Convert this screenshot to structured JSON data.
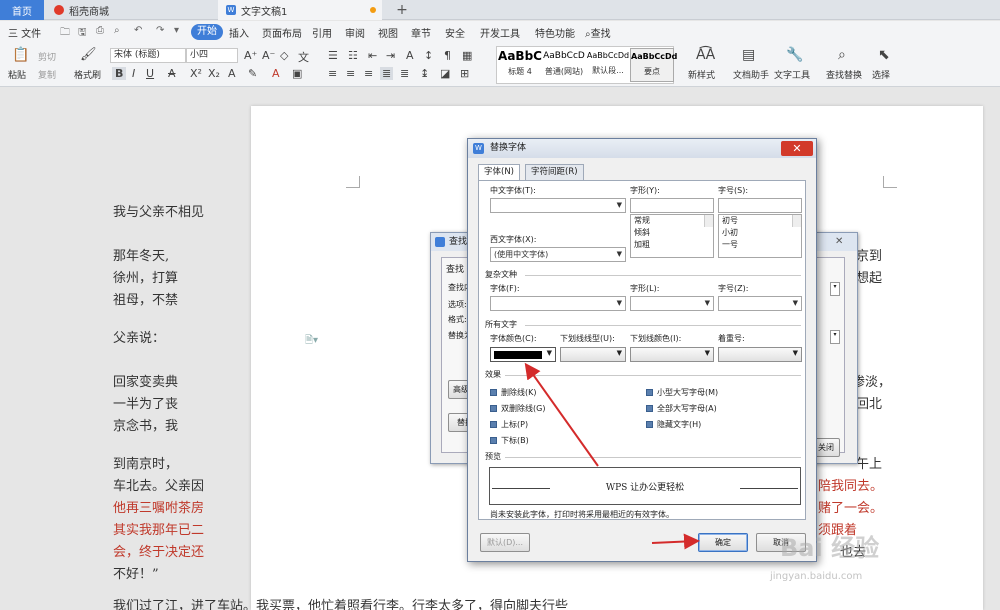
{
  "tabs": {
    "home": "首页",
    "store": "稻壳商城",
    "doc": "文字文稿1",
    "add": "+"
  },
  "menubar": {
    "file": "三 文件",
    "start": "开始",
    "items": [
      "插入",
      "页面布局",
      "引用",
      "审阅",
      "视图",
      "章节",
      "安全",
      "开发工具",
      "特色功能",
      "查找"
    ]
  },
  "toolbar": {
    "paste": "粘贴",
    "cut": "剪切",
    "copy": "复制",
    "format_painter": "格式刷",
    "font_name": "宋体 (标题)",
    "font_size": "小四",
    "styles": [
      {
        "sample": "AaBbC",
        "name": "标题 4"
      },
      {
        "sample": "AaBbCcD",
        "name": "普通(网站)"
      },
      {
        "sample": "AaBbCcDd",
        "name": "默认段..."
      },
      {
        "sample": "AaBbCcDd",
        "name": "要点"
      }
    ],
    "new_style": "新样式",
    "doc_assistant": "文档助手",
    "text_tools": "文字工具",
    "find_replace": "查找替换",
    "select": "选择"
  },
  "document": {
    "paragraphs": [
      {
        "text": "我与父亲不相见",
        "red": false
      },
      {
        "text": "那年冬天,",
        "red": false
      },
      {
        "text": "徐州，打算",
        "red": false
      },
      {
        "text": "祖母，不禁",
        "red": false
      },
      {
        "text": "父亲说：",
        "red": false
      },
      {
        "text": "回家变卖典",
        "red": false
      },
      {
        "text": "一半为了丧",
        "red": false
      },
      {
        "text": "京念书，我",
        "red": false
      },
      {
        "text": "到南京时，",
        "red": false
      },
      {
        "text": "车北去。父亲因",
        "red": true
      },
      {
        "text": "他再三嘱咐茶房",
        "red": true
      },
      {
        "text": "其实我那年已二",
        "red": true
      },
      {
        "text": "会，终于决定还",
        "red": true
      },
      {
        "text": "不好！”",
        "red": false
      },
      {
        "text": "我们过了江，进了车站。我买票，他忙着照看行李。行李太多了，得向脚夫行些",
        "red": false
      }
    ],
    "right_fragments": [
      "京到",
      "想起",
      "渗淡，",
      "回北",
      "午上",
      "陪我同去。",
      "赌了一会。",
      "须跟着",
      "也去",
      "不好"
    ]
  },
  "find_dialog": {
    "title": "查找和替换",
    "tab": "查找",
    "labels": [
      "查找内容",
      "选项:",
      "格式:",
      "替换为"
    ],
    "advanced": "高级搜",
    "replace": "替换",
    "close_btn": "关闭"
  },
  "font_dialog": {
    "title": "替换字体",
    "tabs": [
      "字体(N)",
      "字符间距(R)"
    ],
    "chinese_font_label": "中文字体(T):",
    "chinese_font_value": "",
    "western_font_label": "西文字体(X):",
    "western_font_value": "(使用中文字体)",
    "style_label": "字形(Y):",
    "style_options": [
      "常规",
      "倾斜",
      "加粗"
    ],
    "size_label": "字号(S):",
    "size_options": [
      "初号",
      "小初",
      "一号"
    ],
    "complex_section": "复杂文种",
    "complex_font_label": "字体(F):",
    "complex_style_label": "字形(L):",
    "complex_size_label": "字号(Z):",
    "all_text_section": "所有文字",
    "font_color_label": "字体颜色(C):",
    "font_color_value": "#000000",
    "underline_label": "下划线线型(U):",
    "underline_color_label": "下划线颜色(I):",
    "emphasis_label": "着重号:",
    "effects_section": "效果",
    "effects_left": [
      "删除线(K)",
      "双删除线(G)",
      "上标(P)",
      "下标(B)"
    ],
    "effects_right": [
      "小型大写字母(M)",
      "全部大写字母(A)",
      "隐藏文字(H)"
    ],
    "preview_section": "预览",
    "preview_text": "WPS 让办公更轻松",
    "note": "尚未安装此字体，打印时将采用最相近的有效字体。",
    "default_btn": "默认(D)...",
    "ok_btn": "确定",
    "cancel_btn": "取消"
  },
  "annotation_color": "#d42b2b",
  "watermark": {
    "main": "Bai 经验",
    "sub": "jingyan.baidu.com"
  }
}
